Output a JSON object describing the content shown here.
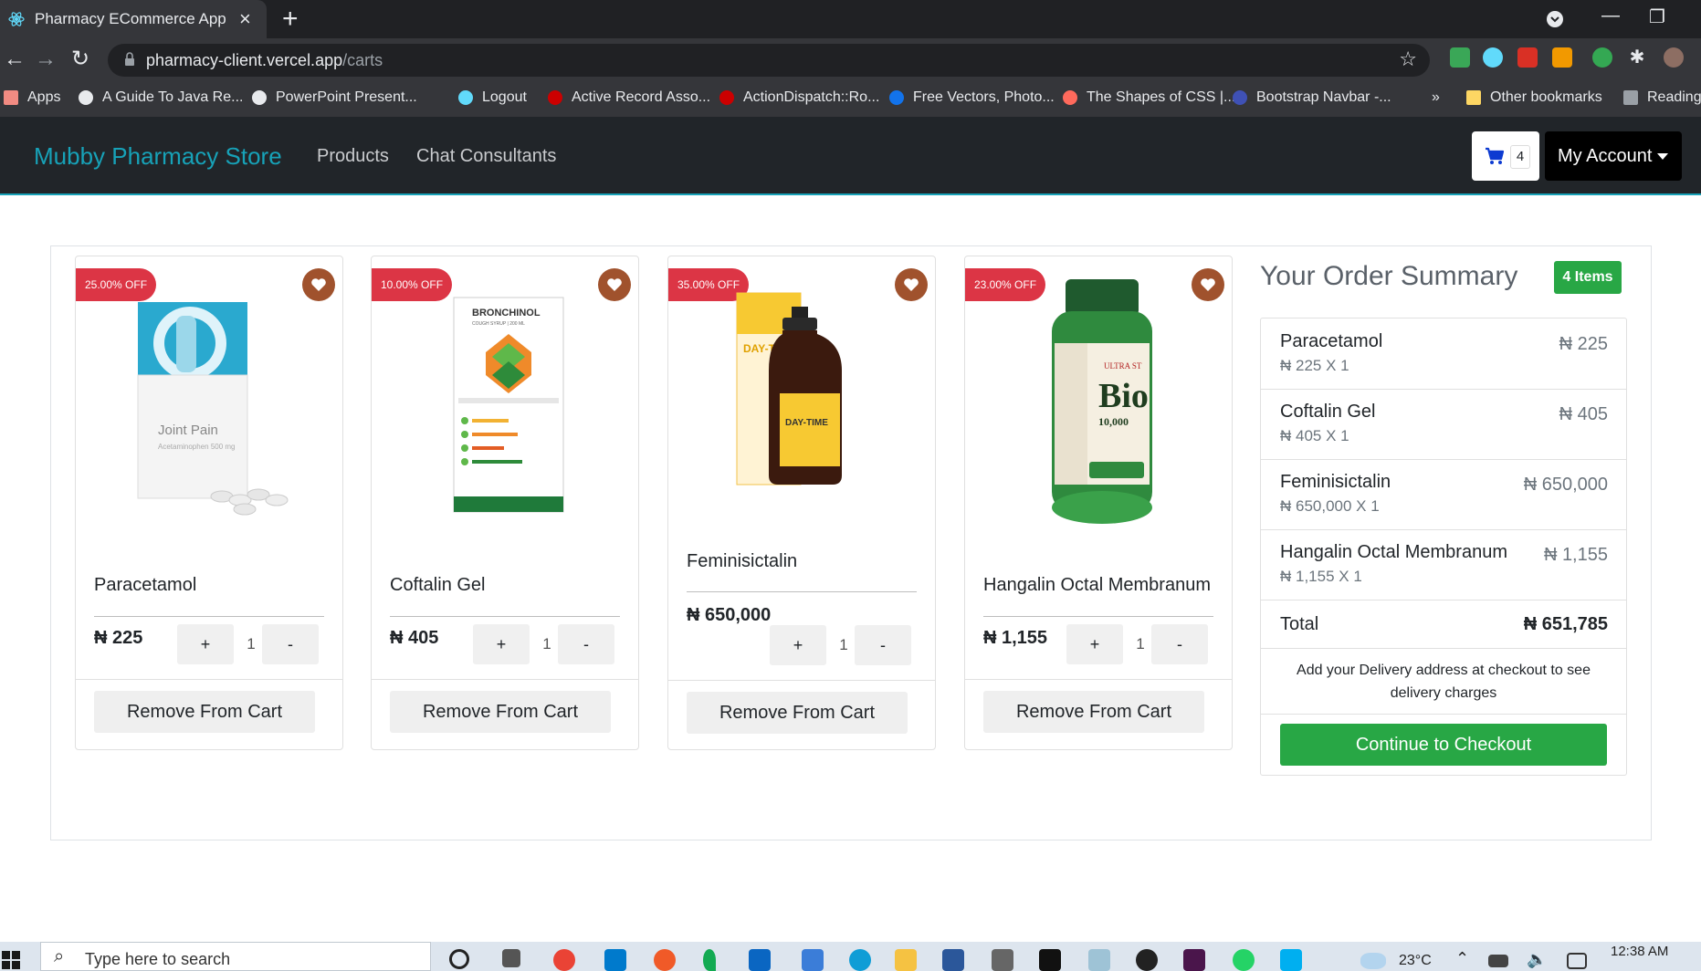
{
  "browser": {
    "tab_title": "Pharmacy ECommerce App",
    "url_host": "pharmacy-client.vercel.app",
    "url_path": "/carts",
    "bookmarks": [
      "Apps",
      "A Guide To Java Re...",
      "PowerPoint Present...",
      "Logout",
      "Active Record Asso...",
      "ActionDispatch::Ro...",
      "Free Vectors, Photo...",
      "The Shapes of CSS |...",
      "Bootstrap Navbar -...",
      "»",
      "Other bookmarks",
      "Reading list"
    ]
  },
  "navbar": {
    "brand": "Mubby Pharmacy Store",
    "links": [
      "Products",
      "Chat Consultants"
    ],
    "cart_count": "4",
    "account_label": "My Account"
  },
  "products": [
    {
      "discount": "25.00% OFF",
      "name": "Paracetamol",
      "price": "₦ 225",
      "qty": "1",
      "remove_label": "Remove From Cart",
      "plus": "+",
      "minus": "-"
    },
    {
      "discount": "10.00% OFF",
      "name": "Coftalin Gel",
      "price": "₦ 405",
      "qty": "1",
      "remove_label": "Remove From Cart",
      "plus": "+",
      "minus": "-"
    },
    {
      "discount": "35.00% OFF",
      "name": "Feminisictalin",
      "price": "₦ 650,000",
      "qty": "1",
      "remove_label": "Remove From Cart",
      "plus": "+",
      "minus": "-"
    },
    {
      "discount": "23.00% OFF",
      "name": "Hangalin Octal Membranum",
      "price": "₦ 1,155",
      "qty": "1",
      "remove_label": "Remove From Cart",
      "plus": "+",
      "minus": "-"
    }
  ],
  "summary": {
    "title": "Your Order Summary",
    "badge": "4 Items",
    "items": [
      {
        "name": "Paracetamol",
        "sub": "₦ 225 X 1",
        "amount": "₦ 225"
      },
      {
        "name": "Coftalin Gel",
        "sub": "₦ 405 X 1",
        "amount": "₦ 405"
      },
      {
        "name": "Feminisictalin",
        "sub": "₦ 650,000 X 1",
        "amount": "₦ 650,000"
      },
      {
        "name": "Hangalin Octal Membranum",
        "sub": "₦ 1,155 X 1",
        "amount": "₦ 1,155"
      }
    ],
    "total_label": "Total",
    "total_amount": "₦ 651,785",
    "delivery_note": "Add your Delivery address at checkout to see delivery charges",
    "checkout_label": "Continue to Checkout"
  },
  "taskbar": {
    "search_placeholder": "Type here to search",
    "temperature": "23°C",
    "time": "12:38 AM"
  },
  "colors": {
    "brand": "#17a2b8",
    "discount": "#dc3545",
    "success": "#28a745",
    "favorite": "#a0522d"
  }
}
